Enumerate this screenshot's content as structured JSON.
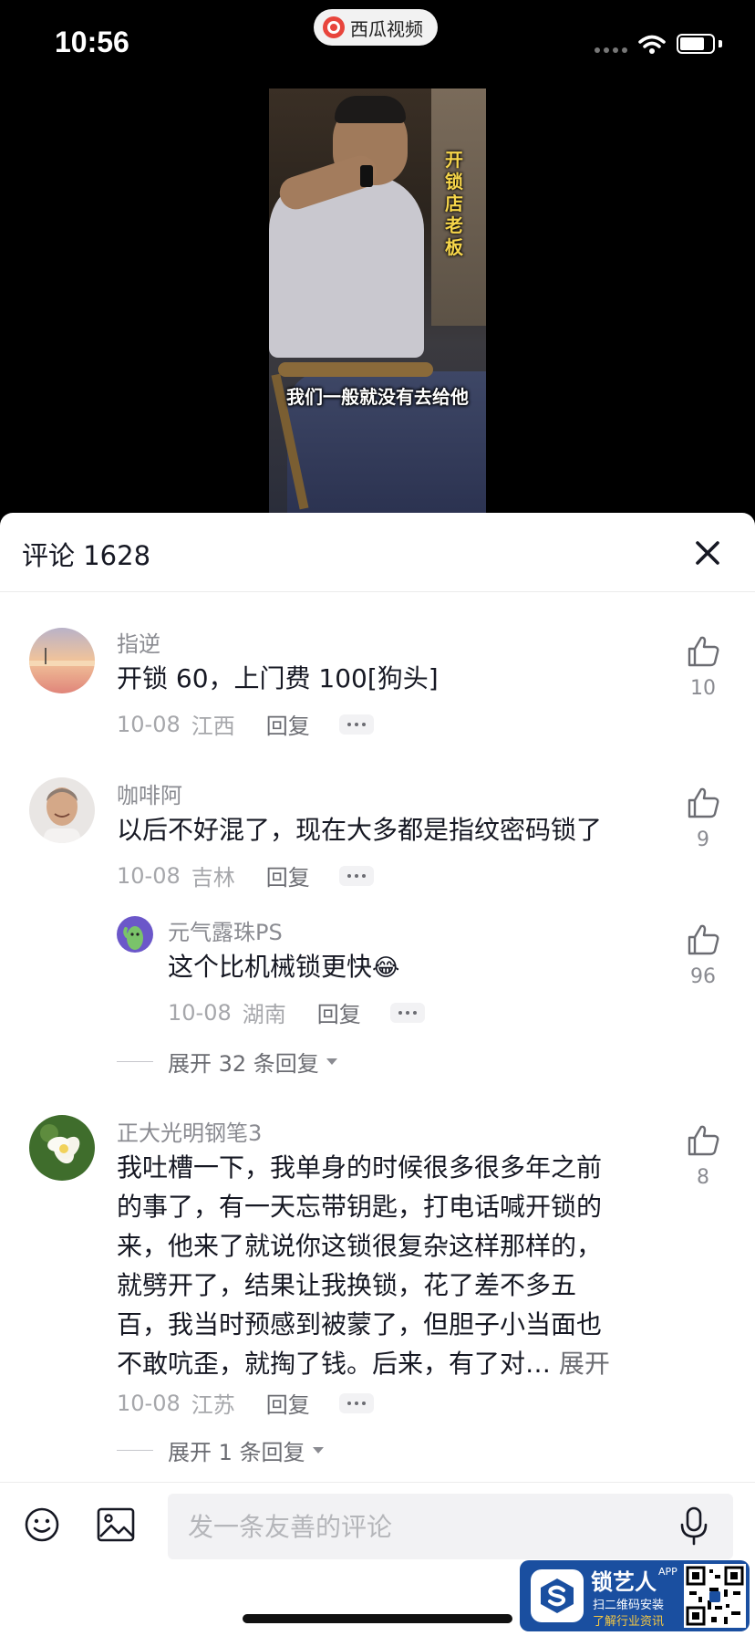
{
  "status_bar": {
    "time": "10:56",
    "app_badge": "西瓜视频"
  },
  "video": {
    "vertical_caption": "开锁店老板",
    "subtitle": "我们一般就没有去给他"
  },
  "comments_panel": {
    "title": "评论 1628",
    "close_icon": "close-icon",
    "comments": [
      {
        "user": "指逆",
        "text": "开锁 60，上门费 100[狗头]",
        "date": "10-08",
        "location": "江西",
        "reply_label": "回复",
        "likes": "10"
      },
      {
        "user": "咖啡阿",
        "text": "以后不好混了，现在大多都是指纹密码锁了",
        "date": "10-08",
        "location": "吉林",
        "reply_label": "回复",
        "likes": "9",
        "replies": [
          {
            "user": "元气露珠PS",
            "text": "这个比机械锁更快",
            "emoji": "😂",
            "date": "10-08",
            "location": "湖南",
            "reply_label": "回复",
            "likes": "96"
          }
        ],
        "expand_text": "展开 32 条回复"
      },
      {
        "user": "正大光明钢笔3",
        "text_lines": [
          "我吐槽一下，我单身的时候很多很多年之前",
          "的事了，有一天忘带钥匙，打电话喊开锁的",
          "来，他来了就说你这锁很复杂这样那样的，",
          "就劈开了，结果让我换锁，花了差不多五",
          "百，我当时预感到被蒙了，但胆子小当面也",
          "不敢吭歪，就掏了钱。后来，有了对…"
        ],
        "expand_link": "展开",
        "date": "10-08",
        "location": "江苏",
        "reply_label": "回复",
        "likes": "8",
        "expand_text": "展开 1 条回复"
      }
    ]
  },
  "input_bar": {
    "placeholder": "发一条友善的评论",
    "icons": [
      "emoji-icon",
      "image-icon",
      "microphone-icon"
    ]
  },
  "watermark": {
    "name": "锁艺人",
    "app_tag": "APP",
    "line1": "扫二维码安装",
    "line2": "了解行业资讯"
  },
  "colors": {
    "sheet_bg": "#ffffff",
    "text_primary": "#161823",
    "text_secondary": "#8a8b91",
    "watermark_bg": "#1a4fa0"
  }
}
